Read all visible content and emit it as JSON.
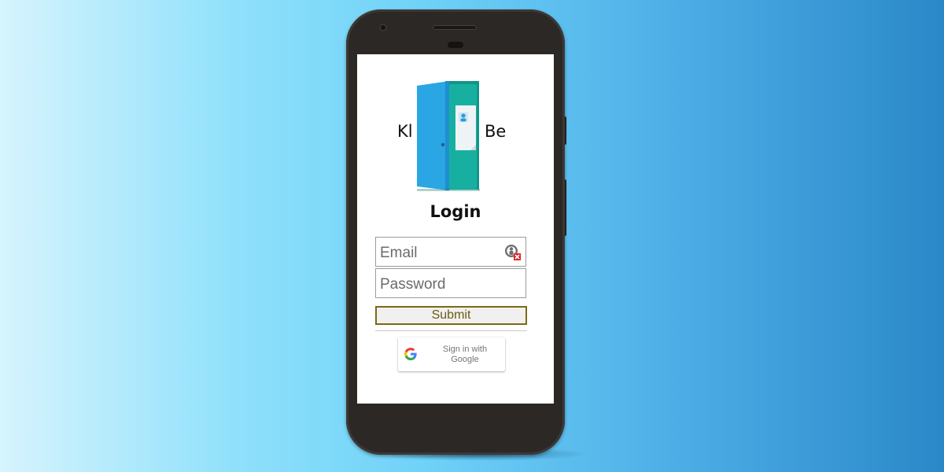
{
  "brand": {
    "left_text": "Kl",
    "right_text": "Be",
    "logo_icon": "door-icon",
    "door_color": "#29a6e3",
    "frame_color": "#17b0a0"
  },
  "login": {
    "title": "Login",
    "email_placeholder": "Email",
    "password_placeholder": "Password",
    "submit_label": "Submit",
    "google_label": "Sign in with Google",
    "autofill_icon": "password-manager-icon"
  },
  "colors": {
    "submit_border": "#7a6a12",
    "background_start": "#d6f4fd",
    "background_end": "#2a88c8"
  }
}
